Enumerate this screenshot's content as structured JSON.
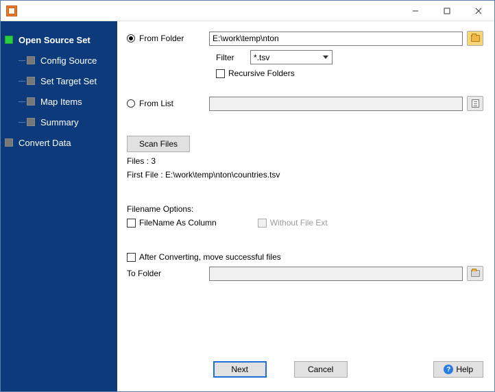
{
  "titlebar": {
    "title": ""
  },
  "sidebar": {
    "items": [
      {
        "label": "Open Source Set",
        "active": true
      },
      {
        "label": "Config Source"
      },
      {
        "label": "Set Target Set"
      },
      {
        "label": "Map Items"
      },
      {
        "label": "Summary"
      },
      {
        "label": "Convert Data"
      }
    ]
  },
  "main": {
    "from_folder_label": "From Folder",
    "from_folder_value": "E:\\work\\temp\\nton",
    "filter_label": "Filter",
    "filter_value": "*.tsv",
    "recursive_label": "Recursive Folders",
    "from_list_label": "From List",
    "from_list_value": "",
    "scan_files_label": "Scan Files",
    "files_count_label": "Files : 3",
    "first_file_label": "First File : E:\\work\\temp\\nton\\countries.tsv",
    "filename_options_label": "Filename Options:",
    "filename_as_column_label": "FileName As Column",
    "without_ext_label": "Without File Ext",
    "after_convert_label": "After Converting, move successful files",
    "to_folder_label": "To Folder",
    "to_folder_value": ""
  },
  "footer": {
    "next_label": "Next",
    "cancel_label": "Cancel",
    "help_label": "Help"
  }
}
